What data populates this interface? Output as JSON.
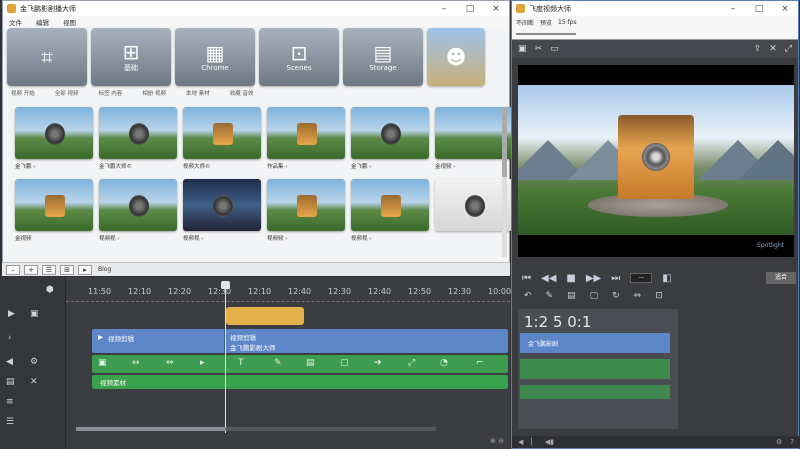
{
  "left_window": {
    "title": "金飞鹏影剧播大师",
    "menu": [
      "文件",
      "编辑",
      "视图"
    ],
    "templates": [
      {
        "label": "",
        "icon": "⌗"
      },
      {
        "label": "基础",
        "icon": "⊞"
      },
      {
        "label": "Chrome",
        "icon": "▦"
      },
      {
        "label": "Scenes",
        "icon": "⊡"
      },
      {
        "label": "Storage",
        "icon": "▤"
      },
      {
        "label": "",
        "icon": "☻"
      }
    ],
    "template_captions": [
      "视频 开始",
      "全部 视频",
      "标签 内容",
      "相册 视频",
      "本地 素材",
      "收藏 音效"
    ],
    "media": [
      {
        "label": "金飞鹏 ›",
        "kind": "day",
        "obj": "wheel"
      },
      {
        "label": "金飞鹏大师©",
        "kind": "day",
        "obj": "wheel"
      },
      {
        "label": "视频大师©",
        "kind": "day",
        "obj": "house"
      },
      {
        "label": "作品集 ›",
        "kind": "day",
        "obj": "house"
      },
      {
        "label": "金飞鹏 ›",
        "kind": "day",
        "obj": "wheel"
      },
      {
        "label": "金视频 ›",
        "kind": "day",
        "obj": "none"
      },
      {
        "label": "金视频",
        "kind": "day",
        "obj": "house"
      },
      {
        "label": "视频视 ›",
        "kind": "day",
        "obj": "wheel"
      },
      {
        "label": "视频视 ›",
        "kind": "dark",
        "obj": "wheel"
      },
      {
        "label": "视频频 ›",
        "kind": "day",
        "obj": "house"
      },
      {
        "label": "视频视 ›",
        "kind": "day",
        "obj": "house"
      },
      {
        "label": "",
        "kind": "plain",
        "obj": "wheel"
      }
    ],
    "toolbar_label": "Blog"
  },
  "timeline": {
    "ruler": [
      "11:50",
      "12:10",
      "12:20",
      "12:30",
      "12:10",
      "12:40",
      "12:30",
      "12:40",
      "12:50",
      "12:30",
      "10:00"
    ],
    "blue_clip_label_a": "视频剪辑",
    "blue_clip_label_b": "视频剪辑",
    "blue_clip_label_c": "金飞鹏影剧大师",
    "green_clip_label": "视频素材"
  },
  "right_window": {
    "title": "飞度视频大师",
    "subbar": [
      "不间断",
      "预览",
      "15 fps"
    ],
    "preview_caption": "Spotlight",
    "fit_label": "适合",
    "timecode": "1:2 5 0:1",
    "panel_clip_label": "金飞鹏影剧"
  },
  "colors": {
    "clip_blue": "#5d86c9",
    "clip_green": "#3d9c4f",
    "clip_yellow": "#e3b04a"
  }
}
